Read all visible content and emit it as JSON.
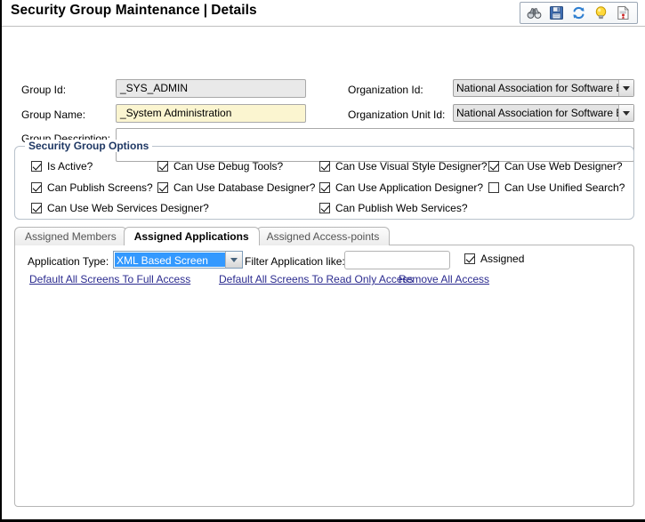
{
  "header": {
    "title_main": "Security Group Maintenance",
    "separator": "|",
    "title_sub": "Details",
    "toolbar": {
      "icons": [
        {
          "name": "binoculars-icon",
          "label": "Search"
        },
        {
          "name": "save-icon",
          "label": "Save"
        },
        {
          "name": "refresh-icon",
          "label": "Refresh"
        },
        {
          "name": "lightbulb-icon",
          "label": "Hint"
        },
        {
          "name": "report-icon",
          "label": "Report"
        }
      ]
    }
  },
  "form": {
    "group_id_label": "Group Id:",
    "group_id_value": "_SYS_ADMIN",
    "group_name_label": "Group Name:",
    "group_name_value": "_System Administration",
    "group_description_label": "Group Description:",
    "group_description_value": "",
    "organization_id_label": "Organization Id:",
    "organization_id_value": "National Association for Software E",
    "organization_unit_id_label": "Organization Unit Id:",
    "organization_unit_id_value": "National Association for Software E"
  },
  "options": {
    "legend": "Security Group Options",
    "checkboxes": [
      {
        "label": "Is Active?",
        "checked": true
      },
      {
        "label": "Can Use Debug Tools?",
        "checked": true
      },
      {
        "label": "Can Use Visual Style Designer?",
        "checked": true
      },
      {
        "label": "Can Use Web Designer?",
        "checked": true
      },
      {
        "label": "Can Publish Screens?",
        "checked": true
      },
      {
        "label": "Can Use Database Designer?",
        "checked": true
      },
      {
        "label": "Can Use Application Designer?",
        "checked": true
      },
      {
        "label": "Can Use Unified Search?",
        "checked": false
      },
      {
        "label": "Can Use Web Services Designer?",
        "checked": true
      },
      {
        "label": "Can Publish Web Services?",
        "checked": true
      }
    ]
  },
  "tabs": [
    {
      "label": "Assigned Members",
      "active": false
    },
    {
      "label": "Assigned Applications",
      "active": true
    },
    {
      "label": "Assigned Access-points",
      "active": false
    }
  ],
  "panel": {
    "application_type_label": "Application Type:",
    "application_type_value": "XML Based Screen",
    "filter_label": "Filter Application like:",
    "filter_value": "",
    "assigned_label": "Assigned",
    "assigned_checked": true,
    "links": [
      "Default All Screens To Full Access",
      "Default All Screens To Read Only Access",
      "Remove All Access"
    ]
  },
  "colors": {
    "required_field": "#fbf5d0",
    "readonly_field": "#e9e9e9",
    "legend_text": "#1f3864",
    "link": "#2b2b8f",
    "combo_selection": "#3399ff"
  }
}
